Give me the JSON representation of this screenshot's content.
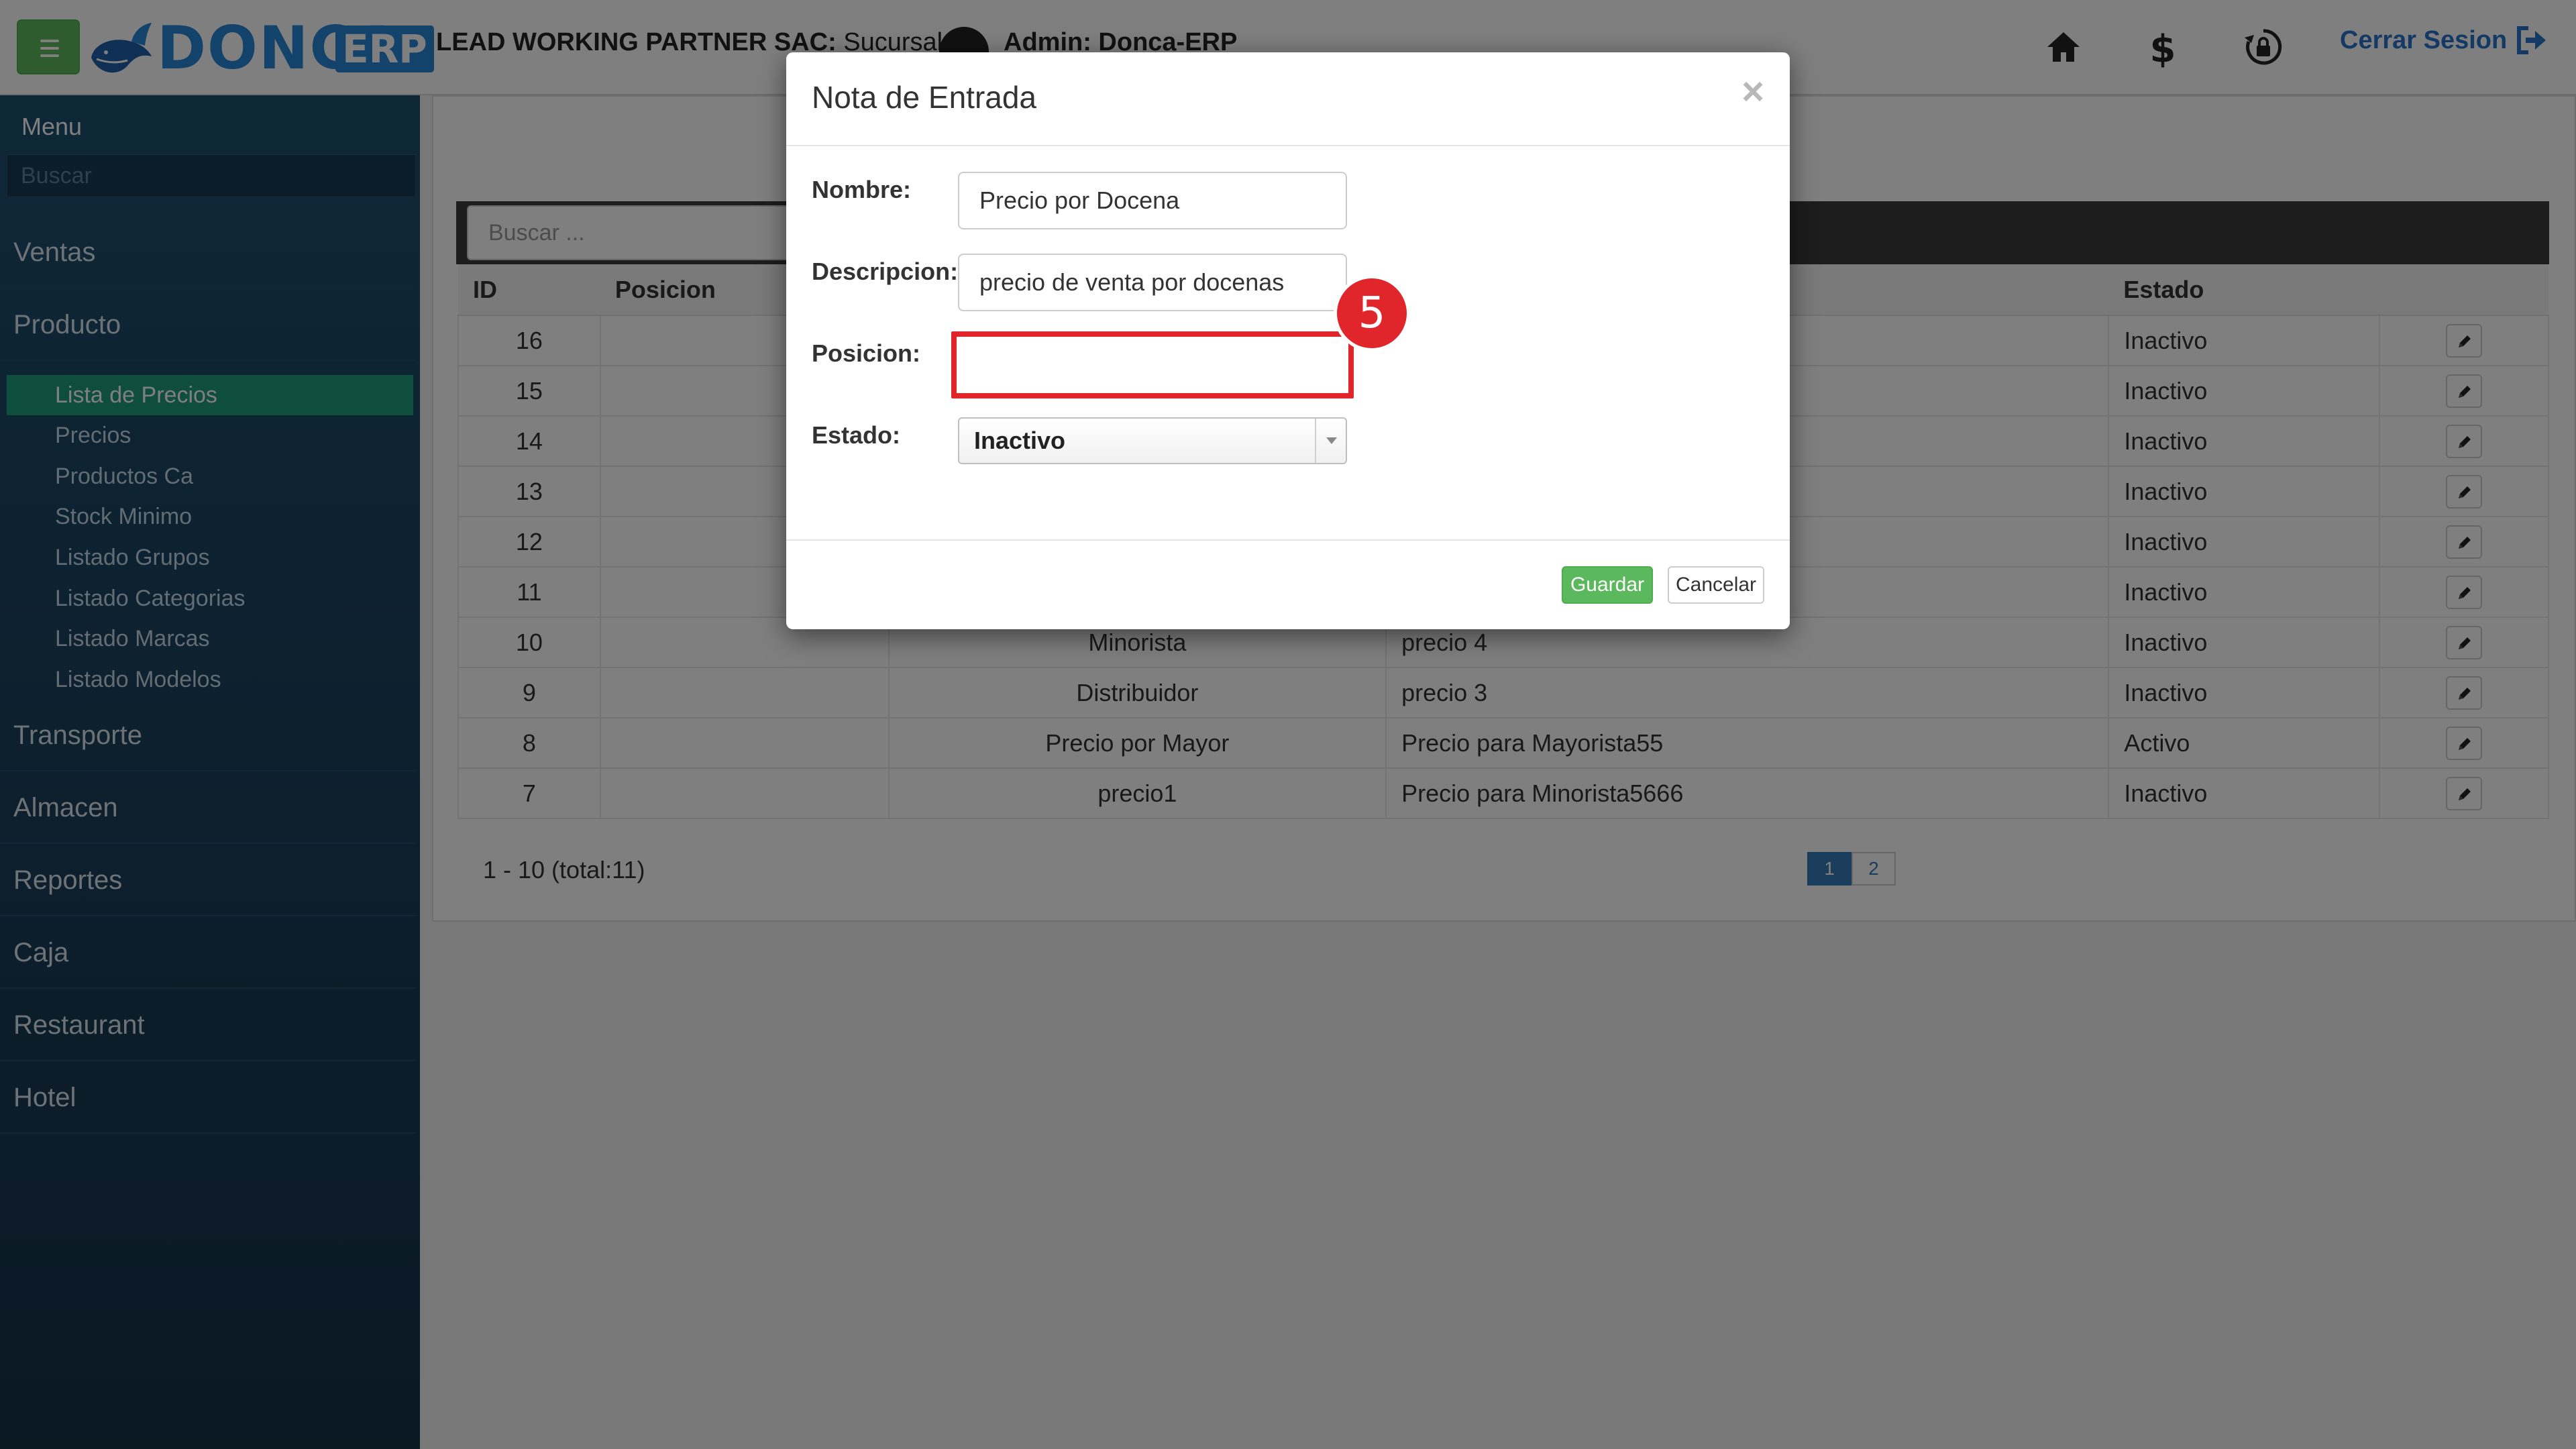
{
  "header": {
    "logo_text": "DONCA",
    "logo_badge": "ERP",
    "company": "LEAD WORKING PARTNER SAC:",
    "sucursal": " Sucursal k |",
    "admin": "Admin: Donca-ERP",
    "logout_label": "Cerrar Sesion",
    "icons": [
      "home-icon",
      "dollar-icon",
      "lock-refresh-icon",
      "logout-icon"
    ]
  },
  "sidebar": {
    "menu_label": "Menu",
    "search_placeholder": "Buscar",
    "items": [
      "Ventas",
      "Producto",
      "Transporte",
      "Almacen",
      "Reportes",
      "Caja",
      "Restaurant",
      "Hotel"
    ],
    "producto_subitems": [
      "Lista de Precios",
      "Precios",
      "Productos Ca",
      "Stock Minimo",
      "Listado Grupos",
      "Listado Categorias",
      "Listado Marcas",
      "Listado Modelos"
    ],
    "active_subitem": "Lista de Precios"
  },
  "table": {
    "search_placeholder": "Buscar ...",
    "columns": [
      "ID",
      "Posicion",
      "",
      "",
      "Estado",
      ""
    ],
    "rows": [
      {
        "id": "16",
        "posicion": "",
        "nombre": "",
        "descripcion": "",
        "estado": "Inactivo"
      },
      {
        "id": "15",
        "posicion": "",
        "nombre": "",
        "descripcion": "",
        "estado": "Inactivo"
      },
      {
        "id": "14",
        "posicion": "",
        "nombre": "",
        "descripcion": "",
        "estado": "Inactivo"
      },
      {
        "id": "13",
        "posicion": "",
        "nombre": "",
        "descripcion": "",
        "estado": "Inactivo"
      },
      {
        "id": "12",
        "posicion": "",
        "nombre": "",
        "descripcion": "",
        "estado": "Inactivo"
      },
      {
        "id": "11",
        "posicion": "",
        "nombre": "",
        "descripcion": "",
        "estado": "Inactivo"
      },
      {
        "id": "10",
        "posicion": "",
        "nombre": "Minorista",
        "descripcion": "precio 4",
        "estado": "Inactivo"
      },
      {
        "id": "9",
        "posicion": "",
        "nombre": "Distribuidor",
        "descripcion": "precio 3",
        "estado": "Inactivo"
      },
      {
        "id": "8",
        "posicion": "",
        "nombre": "Precio por Mayor",
        "descripcion": "Precio para Mayorista55",
        "estado": "Activo"
      },
      {
        "id": "7",
        "posicion": "",
        "nombre": "precio1",
        "descripcion": "Precio para Minorista5666",
        "estado": "Inactivo"
      }
    ],
    "summary": "1 - 10 (total:11)",
    "pages": [
      "1",
      "2"
    ],
    "current_page": "1"
  },
  "modal": {
    "title": "Nota de Entrada",
    "close_symbol": "×",
    "fields": {
      "nombre_label": "Nombre:",
      "nombre_value": "Precio por Docena",
      "descripcion_label": "Descripcion:",
      "descripcion_value": "precio de venta por docenas",
      "posicion_label": "Posicion:",
      "posicion_value": "",
      "estado_label": "Estado:",
      "estado_value": "Inactivo"
    },
    "save_label": "Guardar",
    "cancel_label": "Cancelar"
  },
  "annotation": {
    "step_number": "5",
    "color": "#e0252b"
  },
  "colors": {
    "sidebar_bg": "#1a3e5a",
    "active_item": "#1e9a7b",
    "primary_green": "#5cb85c",
    "link_blue": "#2773c9"
  }
}
